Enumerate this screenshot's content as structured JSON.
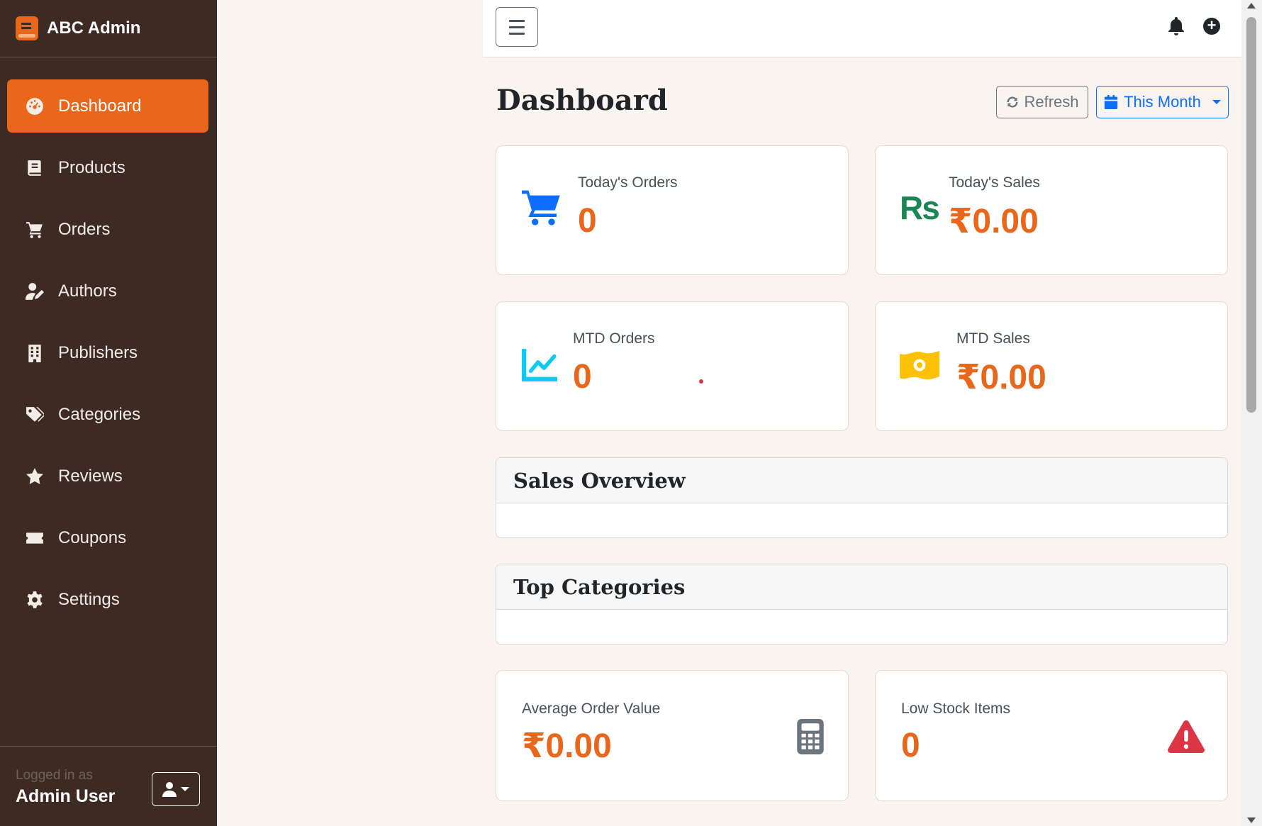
{
  "app": {
    "brand": "ABC Admin",
    "page_title": "Dashboard"
  },
  "sidebar": {
    "items": [
      {
        "label": "Dashboard",
        "icon": "gauge-icon",
        "active": true
      },
      {
        "label": "Products",
        "icon": "book-icon"
      },
      {
        "label": "Orders",
        "icon": "cart-icon"
      },
      {
        "label": "Authors",
        "icon": "user-pen-icon"
      },
      {
        "label": "Publishers",
        "icon": "building-icon"
      },
      {
        "label": "Categories",
        "icon": "tags-icon"
      },
      {
        "label": "Reviews",
        "icon": "star-icon"
      },
      {
        "label": "Coupons",
        "icon": "ticket-icon"
      },
      {
        "label": "Settings",
        "icon": "gear-icon"
      }
    ],
    "footer": {
      "logged_in_label": "Logged in as",
      "user_name": "Admin User"
    }
  },
  "toolbar": {
    "refresh_label": "Refresh",
    "period_label": "This Month"
  },
  "stats": {
    "todays_orders": {
      "label": "Today's Orders",
      "value": "0",
      "icon": "cart-icon"
    },
    "todays_sales": {
      "label": "Today's Sales",
      "value": "₹0.00",
      "icon": "rupee-icon",
      "icon_text": "Rs"
    },
    "mtd_orders": {
      "label": "MTD Orders",
      "value": "0",
      "icon": "chart-line-icon"
    },
    "mtd_sales": {
      "label": "MTD Sales",
      "value": "₹0.00",
      "icon": "money-bill-icon"
    },
    "avg_order_value": {
      "label": "Average Order Value",
      "value": "₹0.00",
      "icon": "calculator-icon"
    },
    "low_stock": {
      "label": "Low Stock Items",
      "value": "0",
      "icon": "warning-icon"
    }
  },
  "sections": {
    "sales_overview": "Sales Overview",
    "top_categories": "Top Categories"
  },
  "colors": {
    "sidebar_bg": "#3d2b23",
    "accent": "#e8671a",
    "page_bg": "#f9f4ef",
    "primary": "#0d6efd",
    "success": "#198754",
    "info": "#0dcaf0",
    "warning": "#ffc107",
    "danger": "#dc3545"
  }
}
